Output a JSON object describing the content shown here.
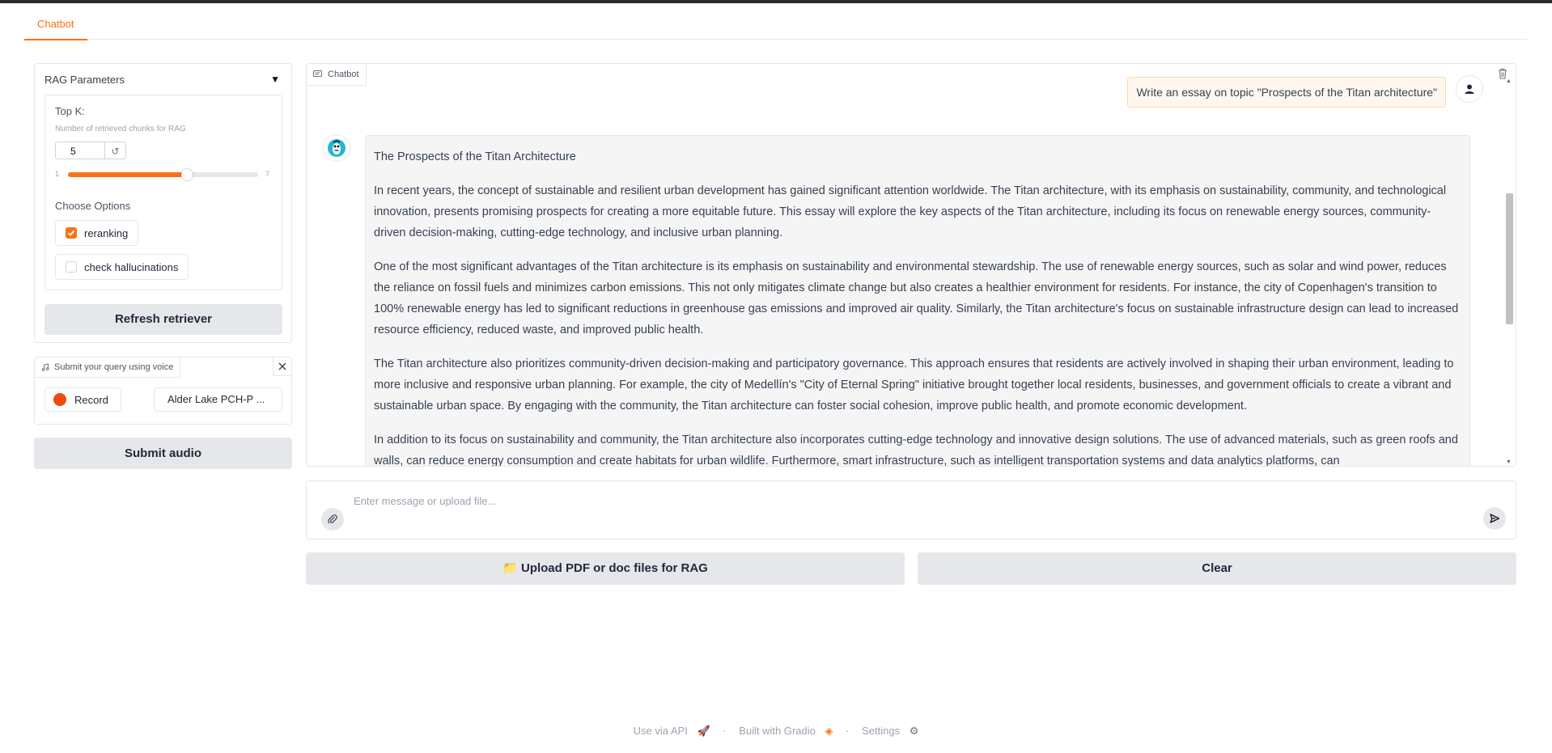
{
  "tabs": [
    {
      "label": "Chatbot"
    }
  ],
  "sidebar": {
    "rag_title": "RAG Parameters",
    "topk": {
      "label": "Top K:",
      "info": "Number of retrieved chunks for RAG",
      "value": "5",
      "min": "1",
      "max": "7",
      "level": 0.625
    },
    "options_label": "Choose Options",
    "options": [
      {
        "label": "reranking",
        "checked": true
      },
      {
        "label": "check hallucinations",
        "checked": false
      }
    ],
    "refresh_label": "Refresh retriever",
    "audio": {
      "label": "Submit your query using voice",
      "record_label": "Record",
      "device": "Alder Lake PCH-P ..."
    },
    "submit_audio_label": "Submit audio"
  },
  "chat": {
    "label": "Chatbot",
    "user_message": "Write an essay on topic \"Prospects of the Titan architecture\"",
    "bot_title": "The Prospects of the Titan Architecture",
    "bot_paragraphs": [
      "In recent years, the concept of sustainable and resilient urban development has gained significant attention worldwide. The Titan architecture, with its emphasis on sustainability, community, and technological innovation, presents promising prospects for creating a more equitable future. This essay will explore the key aspects of the Titan architecture, including its focus on renewable energy sources, community-driven decision-making, cutting-edge technology, and inclusive urban planning.",
      "One of the most significant advantages of the Titan architecture is its emphasis on sustainability and environmental stewardship. The use of renewable energy sources, such as solar and wind power, reduces the reliance on fossil fuels and minimizes carbon emissions. This not only mitigates climate change but also creates a healthier environment for residents. For instance, the city of Copenhagen's transition to 100% renewable energy has led to significant reductions in greenhouse gas emissions and improved air quality. Similarly, the Titan architecture's focus on sustainable infrastructure design can lead to increased resource efficiency, reduced waste, and improved public health.",
      "The Titan architecture also prioritizes community-driven decision-making and participatory governance. This approach ensures that residents are actively involved in shaping their urban environment, leading to more inclusive and responsive urban planning. For example, the city of Medellín's \"City of Eternal Spring\" initiative brought together local residents, businesses, and government officials to create a vibrant and sustainable urban space. By engaging with the community, the Titan architecture can foster social cohesion, improve public health, and promote economic development.",
      "In addition to its focus on sustainability and community, the Titan architecture also incorporates cutting-edge technology and innovative design solutions. The use of advanced materials, such as green roofs and walls, can reduce energy consumption and create habitats for urban wildlife. Furthermore, smart infrastructure, such as intelligent transportation systems and data analytics platforms, can"
    ]
  },
  "input": {
    "placeholder": "Enter message or upload file..."
  },
  "buttons": {
    "upload": "📁 Upload PDF or doc files for RAG",
    "clear": "Clear"
  },
  "footer": {
    "api": "Use via API",
    "built": "Built with Gradio",
    "settings": "Settings",
    "sep": "·"
  },
  "colors": {
    "accent": "#f97316",
    "record": "#ef4b0f"
  }
}
